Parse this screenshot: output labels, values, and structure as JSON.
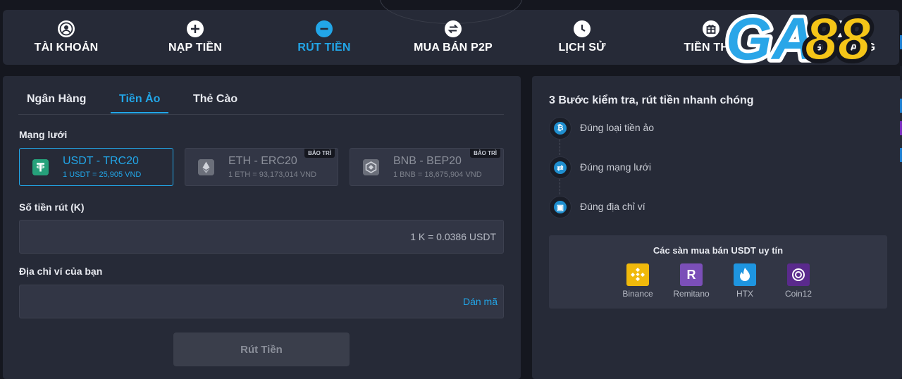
{
  "nav": {
    "items": [
      {
        "label": "TÀI KHOẢN",
        "icon": "user-circle-icon",
        "active": false
      },
      {
        "label": "NẠP TIỀN",
        "icon": "plus-circle-icon",
        "active": false
      },
      {
        "label": "RÚT TIỀN",
        "icon": "minus-circle-icon",
        "active": true
      },
      {
        "label": "MUA BÁN P2P",
        "icon": "swap-circle-icon",
        "active": false
      },
      {
        "label": "LỊCH SỬ",
        "icon": "clock-icon",
        "active": false
      },
      {
        "label": "TIỀN THƯ",
        "icon": "gift-icon",
        "active": false
      },
      {
        "label": "NGÂN HÀNG",
        "icon": "bank-icon",
        "active": false
      }
    ]
  },
  "brand": {
    "logo_text": "GA88",
    "colors": {
      "primary": "#2aa6e8",
      "secondary": "#f5c518"
    }
  },
  "withdraw": {
    "tabs": [
      {
        "label": "Ngân Hàng",
        "active": false
      },
      {
        "label": "Tiền Ảo",
        "active": true
      },
      {
        "label": "Thẻ Cào",
        "active": false
      }
    ],
    "network_label": "Mạng lưới",
    "networks": [
      {
        "name": "USDT - TRC20",
        "rate": "1 USDT = 25,905 VND",
        "icon": "tether-icon",
        "selected": true,
        "badge": ""
      },
      {
        "name": "ETH - ERC20",
        "rate": "1 ETH = 93,173,014 VND",
        "icon": "ethereum-icon",
        "selected": false,
        "badge": "BẢO TRÌ"
      },
      {
        "name": "BNB - BEP20",
        "rate": "1 BNB = 18,675,904 VND",
        "icon": "bnb-icon",
        "selected": false,
        "badge": "BẢO TRÌ"
      }
    ],
    "amount_label": "Số tiền rút (K)",
    "amount_hint": "1 K = 0.0386 USDT",
    "address_label": "Địa chỉ ví của bạn",
    "paste_label": "Dán mã",
    "submit_label": "Rút Tiền"
  },
  "guide": {
    "title": "3 Bước kiểm tra, rút tiền nhanh chóng",
    "steps": [
      {
        "label": "Đúng loại tiền ảo",
        "icon": "coin-icon"
      },
      {
        "label": "Đúng mạng lưới",
        "icon": "network-icon"
      },
      {
        "label": "Đúng địa chỉ ví",
        "icon": "wallet-icon"
      }
    ],
    "exchanges_title": "Các sàn mua bán USDT uy tín",
    "exchanges": [
      {
        "name": "Binance",
        "icon": "binance-icon",
        "color": "#f0b90b"
      },
      {
        "name": "Remitano",
        "icon": "remitano-icon",
        "color": "#7b4fb8"
      },
      {
        "name": "HTX",
        "icon": "htx-icon",
        "color": "#1e95e0"
      },
      {
        "name": "Coin12",
        "icon": "coin12-icon",
        "color": "#5a2a8c"
      }
    ]
  },
  "colors": {
    "accent": "#22a6e8",
    "panel": "#262a37",
    "background": "#15171f"
  }
}
